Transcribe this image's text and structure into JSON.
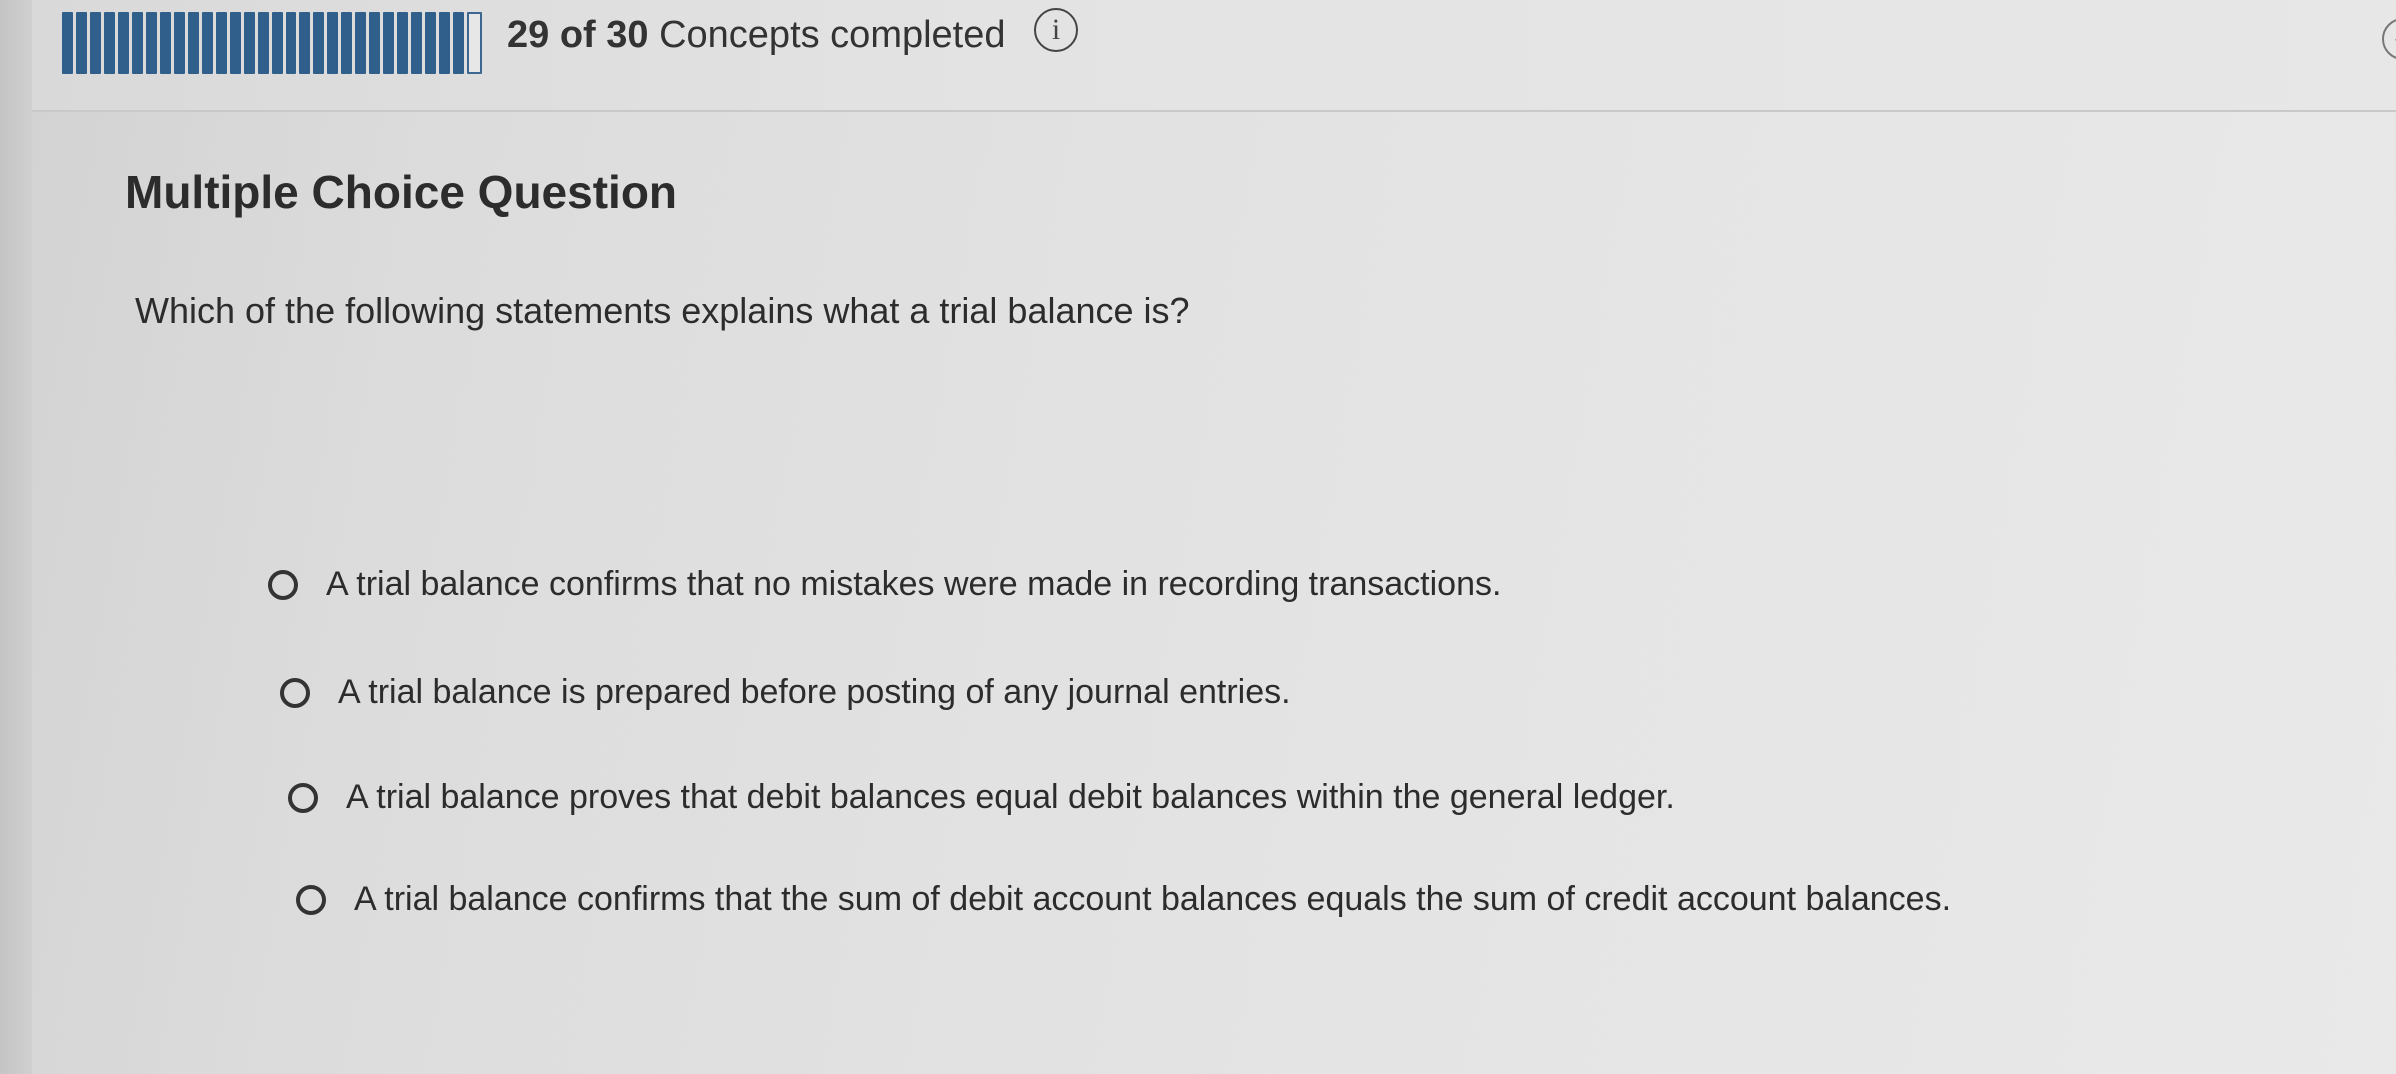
{
  "progress": {
    "completed": 29,
    "total": 30,
    "label_count": "29 of 30",
    "label_text": " Concepts completed"
  },
  "icons": {
    "info": "info-icon",
    "info_glyph": "i",
    "check": "check-icon"
  },
  "question": {
    "type": "Multiple Choice Question",
    "prompt": "Which of the following statements explains what a trial balance is?",
    "options": [
      "A trial balance confirms that no mistakes were made in recording transactions.",
      "A trial balance is prepared before posting of any journal entries.",
      "A trial balance proves that debit balances equal debit balances within the general ledger.",
      "A trial balance confirms that the sum of debit account balances equals the sum of credit account balances."
    ]
  },
  "colors": {
    "progress_fill": "#2f5f8a",
    "text": "#2c2c2c"
  }
}
